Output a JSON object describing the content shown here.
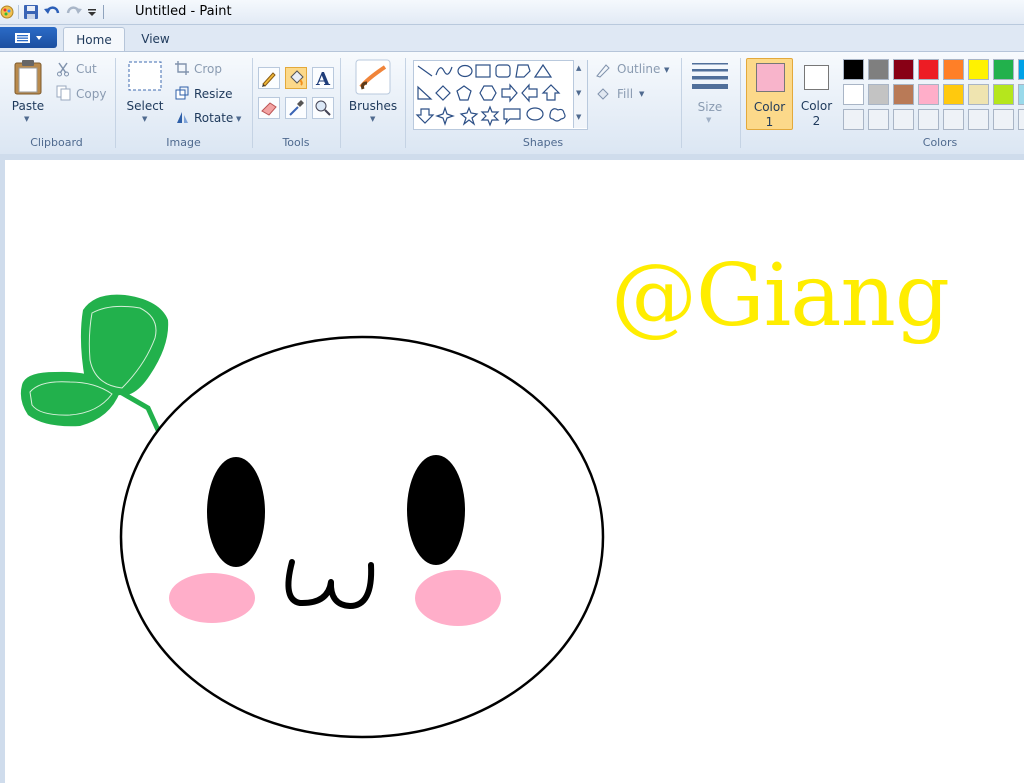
{
  "window": {
    "title": "Untitled - Paint"
  },
  "tabs": {
    "home": "Home",
    "view": "View"
  },
  "clipboard": {
    "paste": "Paste",
    "cut": "Cut",
    "copy": "Copy",
    "group": "Clipboard"
  },
  "image": {
    "select": "Select",
    "crop": "Crop",
    "resize": "Resize",
    "rotate": "Rotate",
    "group": "Image"
  },
  "tools": {
    "group": "Tools"
  },
  "brushes": {
    "label": "Brushes"
  },
  "shapes": {
    "group": "Shapes",
    "outline": "Outline",
    "fill": "Fill"
  },
  "size": {
    "label": "Size"
  },
  "colors": {
    "color1_label": "Color",
    "color1_num": "1",
    "color2_label": "Color",
    "color2_num": "2",
    "group": "Colors",
    "color1_value": "#f8b4cb",
    "color2_value": "#ffffff",
    "palette_row1": [
      "#000000",
      "#7f7f7f",
      "#880015",
      "#ed1c24",
      "#ff7f27",
      "#fff200",
      "#22b14c",
      "#00a2e8"
    ],
    "palette_row2": [
      "#ffffff",
      "#c3c3c3",
      "#b97a57",
      "#ffaec9",
      "#ffc90e",
      "#efe4b0",
      "#b5e61d",
      "#99d9ea"
    ]
  },
  "canvas": {
    "text": "@Giang",
    "text_color": "#ffed00",
    "leaf_color": "#22b14c",
    "cheek_color": "#ffaec9"
  }
}
